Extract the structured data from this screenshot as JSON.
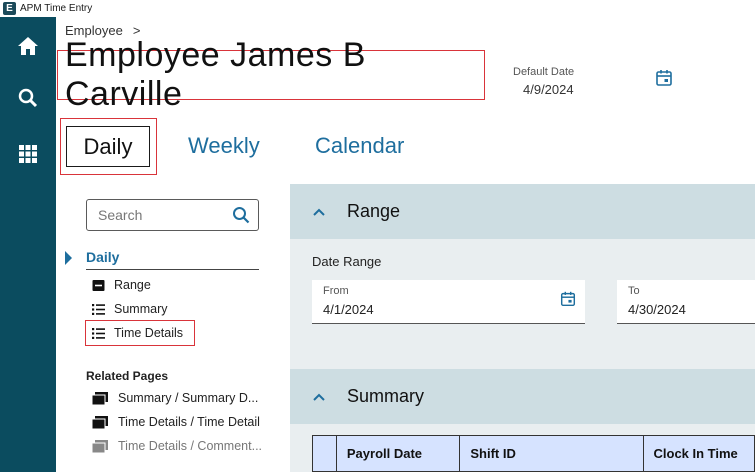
{
  "window": {
    "title": "APM Time Entry",
    "app_icon_letter": "E"
  },
  "rail": {
    "icons": [
      "home-icon",
      "search-icon",
      "apps-grid-icon"
    ]
  },
  "breadcrumb": {
    "items": [
      "Employee"
    ],
    "separator": ">"
  },
  "page": {
    "title": "Employee James B Carville"
  },
  "default_date": {
    "label": "Default Date",
    "value": "4/9/2024"
  },
  "tabs": [
    {
      "label": "Daily",
      "selected": true
    },
    {
      "label": "Weekly",
      "selected": false
    },
    {
      "label": "Calendar",
      "selected": false
    }
  ],
  "sidebar": {
    "search_placeholder": "Search",
    "section": "Daily",
    "items": [
      {
        "label": "Range",
        "icon": "form-icon"
      },
      {
        "label": "Summary",
        "icon": "list-icon"
      },
      {
        "label": "Time Details",
        "icon": "list-icon"
      }
    ],
    "related_title": "Related Pages",
    "related": [
      {
        "label": "Summary / Summary D...",
        "muted": false
      },
      {
        "label": "Time Details / Time Detail",
        "muted": false
      },
      {
        "label": "Time Details / Comment...",
        "muted": true
      }
    ]
  },
  "range_section": {
    "title": "Range",
    "date_range_label": "Date Range",
    "from": {
      "label": "From",
      "value": "4/1/2024"
    },
    "to": {
      "label": "To",
      "value": "4/30/2024"
    }
  },
  "summary_section": {
    "title": "Summary",
    "columns": [
      "",
      "Payroll Date",
      "Shift ID",
      "Clock In Time"
    ]
  },
  "colors": {
    "rail": "#0b4c5f",
    "accent": "#1e6e9e",
    "highlight": "#d9343a",
    "section_header": "#cddde2",
    "table_header": "#d6e3ff"
  }
}
